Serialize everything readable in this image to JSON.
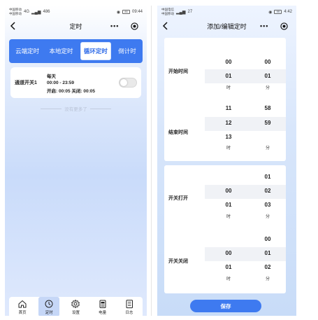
{
  "left": {
    "status": {
      "carrier1": "中国移动",
      "carrier2": "中国移动",
      "net": "4G",
      "speed": "486",
      "time": "09:44",
      "battery": "86"
    },
    "title": "定时",
    "tabs": [
      {
        "label": "云端定时",
        "active": false
      },
      {
        "label": "本地定时",
        "active": false
      },
      {
        "label": "循环定时",
        "active": true
      },
      {
        "label": "倒计时",
        "active": false
      }
    ],
    "timer": {
      "name": "通道开关1",
      "repeat": "每天",
      "range": "00:00 - 23:59",
      "detail": "开启: 00:05 关闭: 00:05",
      "on": false
    },
    "no_more": "没有更多了",
    "nav": [
      {
        "label": "首页",
        "icon": "home-icon",
        "active": false
      },
      {
        "label": "定时",
        "icon": "clock-icon",
        "active": true
      },
      {
        "label": "设置",
        "icon": "gear-icon",
        "active": false
      },
      {
        "label": "电量",
        "icon": "battery-meter-icon",
        "active": false
      },
      {
        "label": "日志",
        "icon": "log-icon",
        "active": false
      }
    ]
  },
  "right": {
    "status": {
      "carrier1": "中国电信",
      "carrier2": "中国移动",
      "speed": "27",
      "time": "4:42",
      "battery": "99"
    },
    "title": "添加/编辑定时",
    "start": {
      "label": "开始时间",
      "hours": [
        "00",
        "01"
      ],
      "minutes": [
        "00",
        "01"
      ],
      "hour_unit": "时",
      "minute_unit": "分"
    },
    "end": {
      "label": "结束时间",
      "hours": [
        "11",
        "12",
        "13"
      ],
      "minutes": [
        "58",
        "59"
      ],
      "hour_unit": "时",
      "minute_unit": "分"
    },
    "on_dur": {
      "label": "开关打开",
      "hours": [
        "00",
        "01"
      ],
      "minutes": [
        "01",
        "02",
        "03"
      ],
      "hour_unit": "时",
      "minute_unit": "分"
    },
    "off_dur": {
      "label": "开关关闭",
      "hours": [
        "00",
        "01"
      ],
      "minutes": [
        "00",
        "01",
        "02"
      ],
      "hour_unit": "时",
      "minute_unit": "分"
    },
    "save_label": "保存"
  },
  "colors": {
    "accent": "#3e7af0",
    "highlight": "#f0f2f6"
  }
}
